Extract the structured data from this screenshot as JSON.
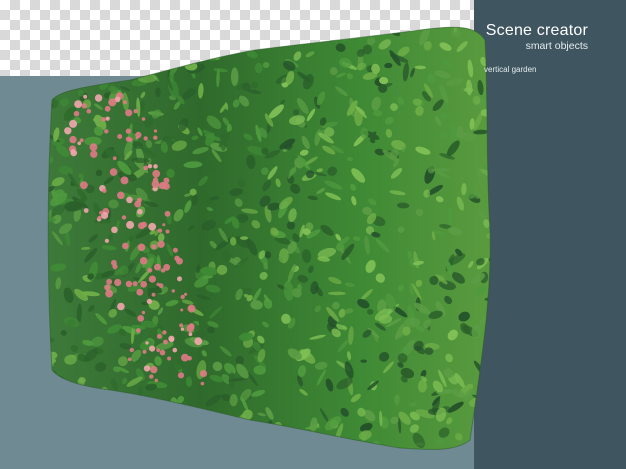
{
  "brand": {
    "title": "Scene creator",
    "subtitle": "smart objects"
  },
  "caption": "vertical garden",
  "colors": {
    "background": "#6f8a93",
    "panel": "#3f5560",
    "leaf_dark": "#2f6b2c",
    "leaf_mid": "#3f8a35",
    "leaf_light": "#6fae48",
    "flower": "#e07a86"
  }
}
